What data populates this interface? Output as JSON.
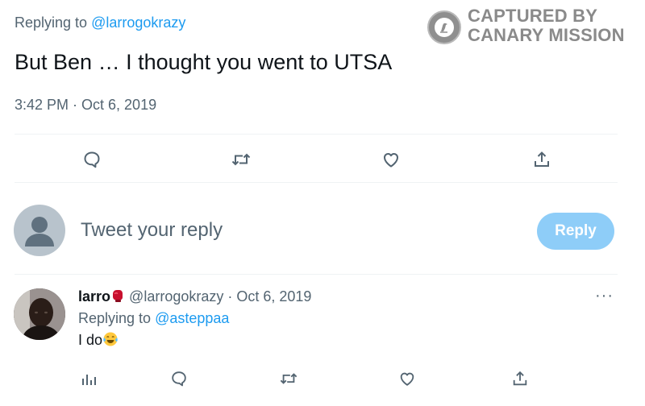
{
  "tweet": {
    "replying_prefix": "Replying to ",
    "replying_handle": "@larrogokrazy",
    "text": "But Ben … I thought you went to UTSA",
    "timestamp": "3:42 PM · Oct 6, 2019"
  },
  "watermark": {
    "line1": "CAPTURED BY",
    "line2": "CANARY MISSION"
  },
  "actions": [
    {
      "icon": "reply-icon"
    },
    {
      "icon": "retweet-icon"
    },
    {
      "icon": "like-icon"
    },
    {
      "icon": "share-icon"
    }
  ],
  "composer": {
    "placeholder": "Tweet your reply",
    "reply_label": "Reply"
  },
  "reply": {
    "name": "larro",
    "name_emoji": "boxing-glove",
    "handle": "@larrogokrazy",
    "date": "· Oct 6, 2019",
    "replying_prefix": "Replying to ",
    "replying_handle": "@asteppaa",
    "text": "I do",
    "text_emoji": "tears-of-joy",
    "more": "···"
  },
  "reply_actions": [
    {
      "icon": "analytics-icon"
    },
    {
      "icon": "reply-icon"
    },
    {
      "icon": "retweet-icon"
    },
    {
      "icon": "like-icon"
    },
    {
      "icon": "share-icon"
    }
  ],
  "colors": {
    "link": "#1d9bf0",
    "reply_button": "#8ecdf8",
    "muted_text": "#536471"
  }
}
